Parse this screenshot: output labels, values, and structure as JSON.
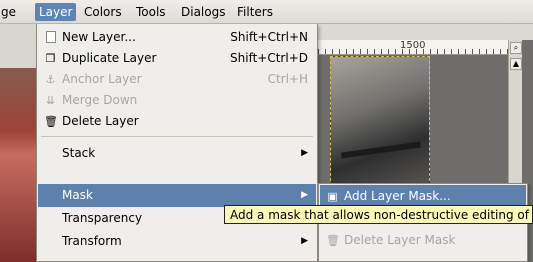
{
  "menubar": {
    "items": [
      {
        "label": "ge"
      },
      {
        "label": "Layer"
      },
      {
        "label": "Colors"
      },
      {
        "label": "Tools"
      },
      {
        "label": "Dialogs"
      },
      {
        "label": "Filters"
      }
    ]
  },
  "ruler": {
    "label": "1500"
  },
  "layer_menu": {
    "items": [
      {
        "label": "New Layer...",
        "shortcut": "Shift+Ctrl+N",
        "icon": "new-layer-icon"
      },
      {
        "label": "Duplicate Layer",
        "shortcut": "Shift+Ctrl+D",
        "icon": "duplicate-layer-icon"
      },
      {
        "label": "Anchor Layer",
        "shortcut": "Ctrl+H",
        "icon": "anchor-icon"
      },
      {
        "label": "Merge Down",
        "shortcut": "",
        "icon": "merge-down-icon"
      },
      {
        "label": "Delete Layer",
        "shortcut": "",
        "icon": "delete-layer-icon"
      },
      {
        "label": "Stack",
        "submenu": true
      },
      {
        "label": "Mask",
        "submenu": true
      },
      {
        "label": "Transparency",
        "submenu": true
      },
      {
        "label": "Transform",
        "submenu": true
      }
    ]
  },
  "mask_submenu": {
    "items": [
      {
        "label": "Add Layer Mask...",
        "icon": "add-layer-mask-icon"
      },
      {
        "label": "Delete Layer Mask",
        "icon": "delete-layer-mask-icon"
      }
    ]
  },
  "tooltip": {
    "text": "Add a mask that allows non-destructive editing of transparency"
  },
  "colors": {
    "highlight": "#5d80ad",
    "tooltip_bg": "#fbf7b6",
    "disabled_text": "#a9a6a0"
  }
}
